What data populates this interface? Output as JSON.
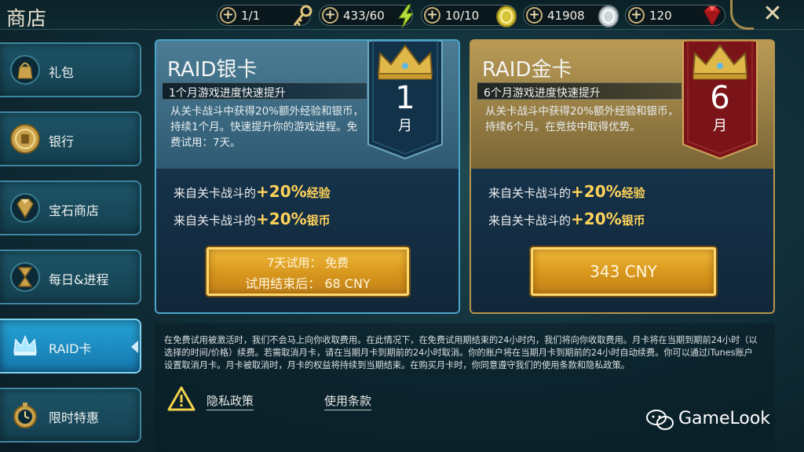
{
  "header": {
    "title": "商店",
    "resources": [
      {
        "value": "1/1",
        "icon": "key-icon"
      },
      {
        "value": "433/60",
        "icon": "energy-icon"
      },
      {
        "value": "10/10",
        "icon": "arena-token-icon"
      },
      {
        "value": "41908",
        "icon": "silver-coin-icon"
      },
      {
        "value": "120",
        "icon": "ruby-gem-icon"
      }
    ],
    "close_icon": "close-icon"
  },
  "sidebar": {
    "items": [
      {
        "label": "礼包",
        "icon": "gift-bag-icon"
      },
      {
        "label": "银行",
        "icon": "bank-coin-icon"
      },
      {
        "label": "宝石商店",
        "icon": "gem-shop-icon"
      },
      {
        "label": "每日&进程",
        "icon": "hourglass-icon"
      },
      {
        "label": "RAID卡",
        "icon": "crown-icon",
        "active": true
      },
      {
        "label": "限时特惠",
        "icon": "timer-icon"
      }
    ]
  },
  "cards": {
    "silver": {
      "title": "RAID银卡",
      "subtitle": "1个月游戏进度快速提升",
      "description": "从关卡战斗中获得20%额外经验和银币，持续1个月。快速提升你的游戏进程。免费试用：7天。",
      "badge_number": "1",
      "badge_unit": "月",
      "benefit1_prefix": "来自关卡战斗的",
      "benefit1_value": "+20%",
      "benefit1_suffix": "经验",
      "benefit2_prefix": "来自关卡战斗的",
      "benefit2_value": "+20%",
      "benefit2_suffix": "银币",
      "button_line1": "7天试用：  免费",
      "button_line2": "试用结束后：  68 CNY"
    },
    "gold": {
      "title": "RAID金卡",
      "subtitle": "6个月游戏进度快速提升",
      "description": "从关卡战斗中获得20%额外经验和银币，持续6个月。在竞技中取得优势。",
      "badge_number": "6",
      "badge_unit": "月",
      "benefit1_prefix": "来自关卡战斗的",
      "benefit1_value": "+20%",
      "benefit1_suffix": "经验",
      "benefit2_prefix": "来自关卡战斗的",
      "benefit2_value": "+20%",
      "benefit2_suffix": "银币",
      "button_label": "343 CNY"
    }
  },
  "legal": {
    "text": "在免费试用被激活时，我们不会马上向你收取费用。在此情况下，在免费试用期结束的24小时内，我们将向你收取费用。月卡将在当期到期前24小时（以选择的时间/价格）续费。若需取消月卡，请在当期月卡到期前的24小时取消。你的账户将在当期月卡到期前的24小时自动续费。你可以通过iTunes账户设置取消月卡。月卡被取消时，月卡的权益将持续到当期结束。在购买月卡时，你同意遵守我们的使用条款和隐私政策。",
    "privacy_link": "隐私政策",
    "terms_link": "使用条款",
    "warning_icon": "warning-icon"
  },
  "watermark": {
    "text": "GameLook",
    "icon": "wechat-icon"
  },
  "colors": {
    "accent_gold": "#ffd35a",
    "button_gold": "#e0a024",
    "active_tab": "#1f8cc3",
    "silver_banner": "#12324a",
    "gold_banner": "#7a1418"
  }
}
